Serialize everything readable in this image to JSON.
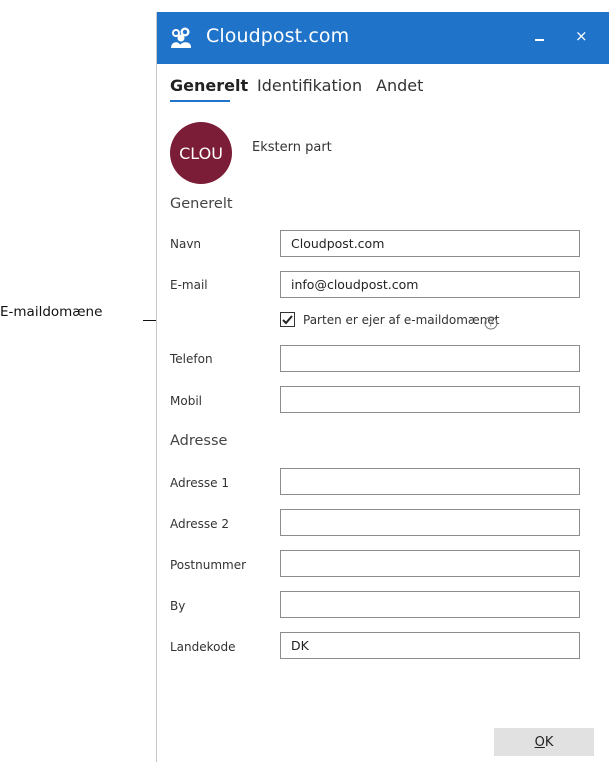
{
  "annotation": {
    "label": "E-maildomæne"
  },
  "window": {
    "title": "Cloudpost.com",
    "icon": "cloud-people-icon",
    "minimize_icon": "minimize-icon",
    "close_glyph": "×"
  },
  "tabs": [
    {
      "label": "Generelt",
      "active": true
    },
    {
      "label": "Identifikation",
      "active": false
    },
    {
      "label": "Andet",
      "active": false
    }
  ],
  "party": {
    "avatar_text": "CLOU",
    "type": "Ekstern part",
    "avatar_color": "#7b1d37"
  },
  "general": {
    "heading": "Generelt",
    "name_label": "Navn",
    "name_value": "Cloudpost.com",
    "email_label": "E-mail",
    "email_value": "info@cloudpost.com",
    "domain_checkbox_label": "Parten er ejer af e-maildomænet",
    "domain_checked": true,
    "phone_label": "Telefon",
    "phone_value": "",
    "mobile_label": "Mobil",
    "mobile_value": ""
  },
  "address": {
    "heading": "Adresse",
    "address1_label": "Adresse 1",
    "address1_value": "",
    "address2_label": "Adresse 2",
    "address2_value": "",
    "postal_label": "Postnummer",
    "postal_value": "",
    "city_label": "By",
    "city_value": "",
    "country_label": "Landekode",
    "country_value": "DK"
  },
  "footer": {
    "ok_label": "OK"
  },
  "colors": {
    "accent": "#1f74c9"
  }
}
